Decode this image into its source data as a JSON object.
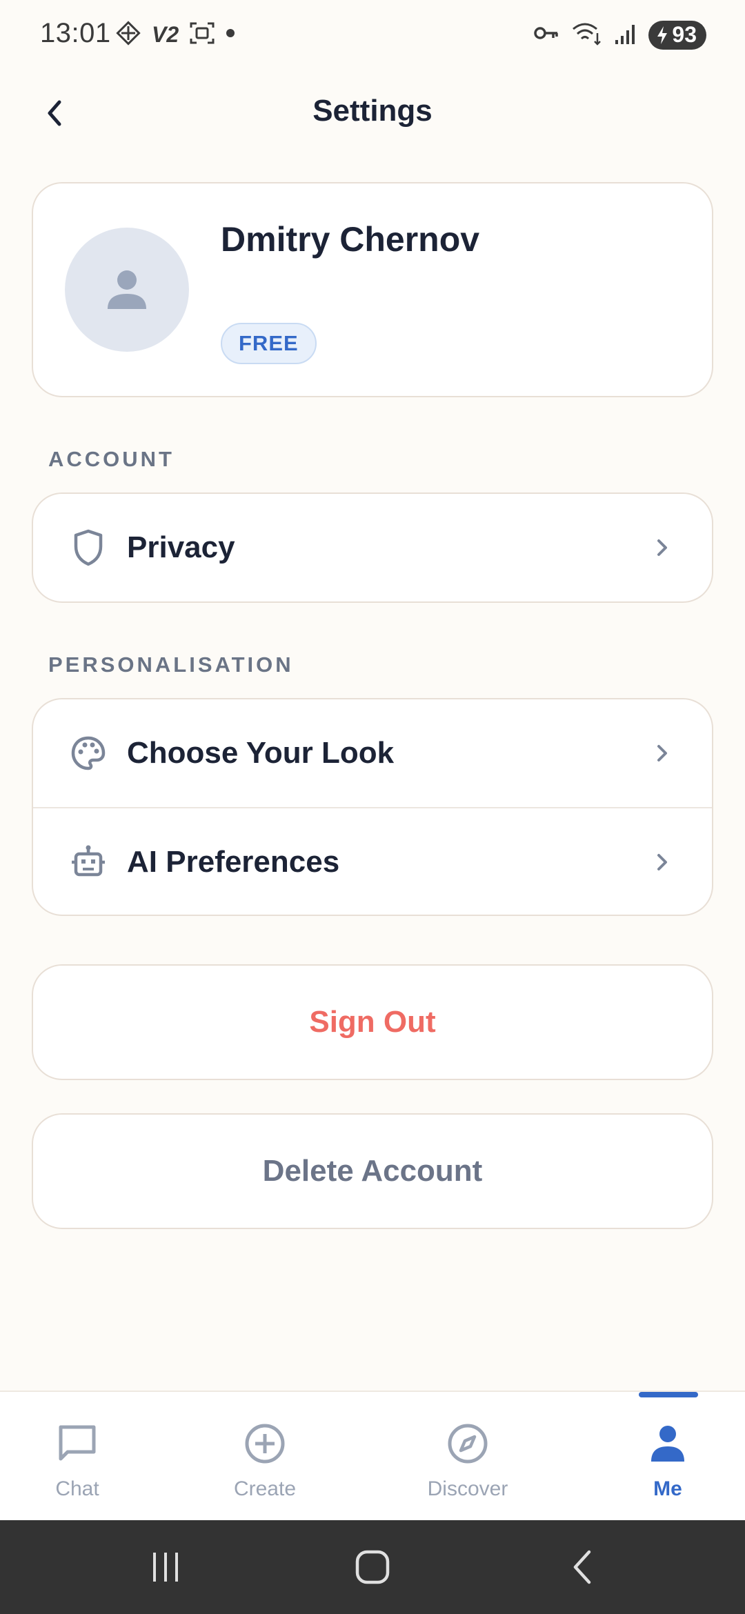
{
  "status_bar": {
    "time": "13:01",
    "left_icons": [
      "app-notification-icon",
      "v2-icon",
      "screenshot-icon",
      "dot-icon"
    ],
    "v2_text": "V2",
    "right_icons": [
      "vpn-key-icon",
      "wifi-icon",
      "signal-icon"
    ],
    "battery": "93"
  },
  "header": {
    "title": "Settings"
  },
  "profile": {
    "name": "Dmitry Chernov",
    "plan": "FREE"
  },
  "sections": {
    "account_label": "ACCOUNT",
    "personalisation_label": "PERSONALISATION"
  },
  "account_items": [
    {
      "label": "Privacy",
      "icon": "shield-icon"
    }
  ],
  "personalisation_items": [
    {
      "label": "Choose Your Look",
      "icon": "palette-icon"
    },
    {
      "label": "AI Preferences",
      "icon": "robot-icon"
    }
  ],
  "actions": {
    "sign_out": "Sign Out",
    "delete_account": "Delete Account"
  },
  "bottom_nav": {
    "items": [
      {
        "label": "Chat",
        "icon": "chat-bubble-icon",
        "active": false
      },
      {
        "label": "Create",
        "icon": "plus-circle-icon",
        "active": false
      },
      {
        "label": "Discover",
        "icon": "compass-icon",
        "active": false
      },
      {
        "label": "Me",
        "icon": "person-icon",
        "active": true
      }
    ]
  },
  "colors": {
    "accent": "#3469c8",
    "danger": "#ef6b63",
    "background": "#fdfbf7",
    "card_border": "#e8dfd6"
  }
}
